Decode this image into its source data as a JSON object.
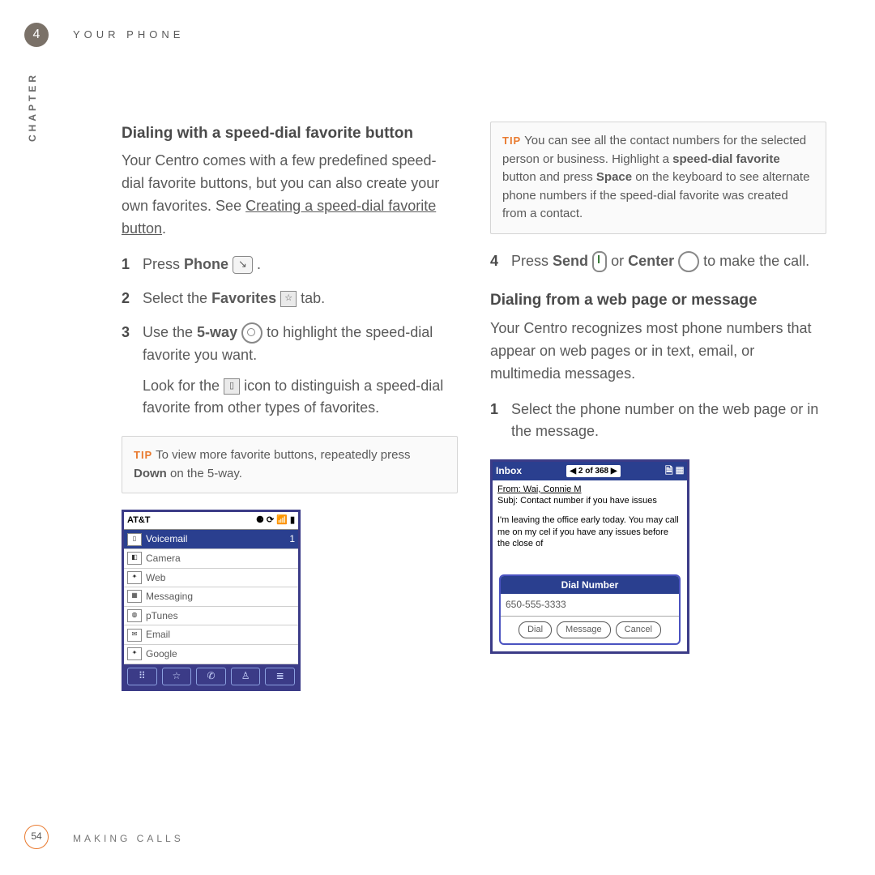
{
  "chapter_number": "4",
  "chapter_title": "YOUR PHONE",
  "side_label": "CHAPTER",
  "page_number": "54",
  "footer_text": "MAKING CALLS",
  "left": {
    "heading": "Dialing with a speed-dial favorite button",
    "intro_pre": "Your Centro comes with a few predefined speed-dial favorite buttons, but you can also create your own favorites. See ",
    "intro_link": "Creating a speed-dial favorite button",
    "intro_post": ".",
    "step1_n": "1",
    "step1_a": "Press ",
    "step1_b": "Phone",
    "step1_c": " .",
    "step2_n": "2",
    "step2_a": "Select the ",
    "step2_b": "Favorites",
    "step2_c": " tab.",
    "step3_n": "3",
    "step3_a": "Use the ",
    "step3_b": "5-way",
    "step3_c": " to highlight the speed-dial favorite you want.",
    "step3_look_a": "Look for the ",
    "step3_look_b": " icon to distinguish a speed-dial favorite from other types of favorites.",
    "tip_label": "TIP",
    "tip_a": " To view more favorite buttons, repeatedly press ",
    "tip_b": "Down",
    "tip_c": " on the 5-way.",
    "shot": {
      "carrier": "AT&T",
      "status_icons": "⚈   ⟳  📶 ▮",
      "rows": [
        {
          "icon": "▯",
          "label": "Voicemail",
          "num": "1",
          "sel": true
        },
        {
          "icon": "◧",
          "label": "Camera"
        },
        {
          "icon": "✦",
          "label": "Web"
        },
        {
          "icon": "▦",
          "label": "Messaging"
        },
        {
          "icon": "◍",
          "label": "pTunes"
        },
        {
          "icon": "✉",
          "label": "Email"
        },
        {
          "icon": "✦",
          "label": "Google"
        }
      ],
      "tab_icons": [
        "⠿",
        "☆",
        "✆",
        "♙",
        "≣"
      ]
    }
  },
  "right": {
    "tip_label": "TIP",
    "tip_a": " You can see all the contact numbers for the selected person or business. Highlight a ",
    "tip_b": "speed-dial favorite",
    "tip_c": " button and press ",
    "tip_d": "Space",
    "tip_e": " on the keyboard to see alternate phone numbers if the speed-dial favorite was created from a contact.",
    "step4_n": "4",
    "step4_a": "Press ",
    "step4_b": "Send",
    "step4_c": " or ",
    "step4_d": "Center",
    "step4_e": " to make the call.",
    "heading2": "Dialing from a web page or message",
    "intro2": "Your Centro recognizes most phone numbers that appear on web pages or in text, email, or multimedia messages.",
    "r1_n": "1",
    "r1_txt": "Select the phone number on the web page or in the message.",
    "shot2": {
      "inbox": "Inbox",
      "counter": "◀ 2 of 368 ▶",
      "from_line": "From: Wai, Connie M",
      "subject": "Subj: Contact number if you have issues",
      "body": "I'm leaving the office early today. You may call me on my cel if you have any issues before the close of",
      "popup_title": "Dial Number",
      "popup_number": "650-555-3333",
      "buttons": [
        "Dial",
        "Message",
        "Cancel"
      ]
    }
  }
}
